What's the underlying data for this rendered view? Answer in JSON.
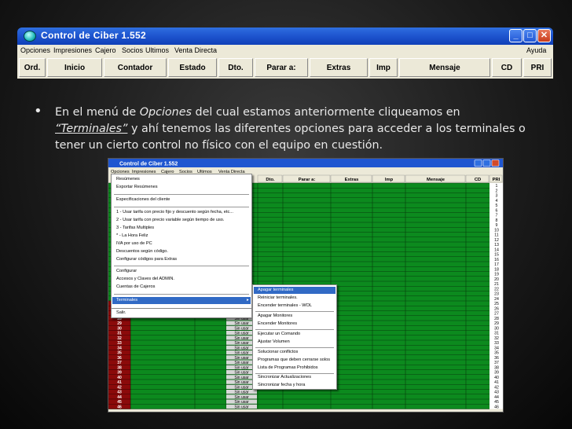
{
  "window": {
    "title": "Control de Ciber 1.552",
    "menu": [
      "Opciones",
      "Impresiones",
      "Cajero",
      "Socios",
      "Ultimos",
      "Venta Directa"
    ],
    "help": "Ayuda",
    "toolbar": [
      "Ord.",
      "Inicio",
      "Contador",
      "Estado",
      "Dto.",
      "Parar a:",
      "Extras",
      "Imp",
      "Mensaje",
      "CD",
      "PRI"
    ],
    "buttons": {
      "minimize": "_",
      "maximize": "□",
      "close": "✕"
    }
  },
  "bullet": {
    "marker": "•",
    "before": "En el menú de ",
    "opciones": "Opciones",
    "mid": " del cual estamos anteriormente cliqueamos en",
    "terminales": "“Terminales”",
    "after": " y ahí tenemos las diferentes opciones para acceder a los terminales o tener un cierto control no físico con el equipo en cuestión."
  },
  "shot": {
    "title": "Control de Ciber 1.552",
    "menu": [
      "Opciones",
      "Impresiones",
      "Cajero",
      "Socios",
      "Ultimos",
      "Venta Directa"
    ],
    "columns": [
      "Dto.",
      "Parar a:",
      "Extras",
      "Imp",
      "Mensaje",
      "CD",
      "PRI"
    ],
    "opciones_menu": [
      "Resúmenes",
      "Exportar Resúmenes",
      "Especificaciones del cliente",
      "1 - Usar tarifa con precio fijo y descuento según fecha, etc...",
      "2 - Usar tarifa con precio variable según tiempo de uso.",
      "3 - Tarifas Multiples",
      "* - La Hora Feliz",
      "IVA por uso de PC",
      "Descuentos según código.",
      "Configurar códigos para Extras",
      "Configurar",
      "Accesos y Claves del ADMIN.",
      "Cuentas de Cajeros",
      "Terminales",
      "Salir."
    ],
    "terminales_menu": [
      "Apagar terminales",
      "Reiniciar terminales.",
      "Encender terminales - WOL",
      "Apagar Monitores",
      "Encender Monitores",
      "Ejecutar un Comando",
      "Ajustar Volumen",
      "Solucionar conflictos",
      "Programas que deben cerrarse solos",
      "Lista de Programas Prohibidos",
      "Sincronizar Actualizaciones",
      "Sincronizar fecha y hora"
    ],
    "row_numbers": [
      "1",
      "2",
      "3",
      "4",
      "5",
      "6",
      "7",
      "8",
      "9",
      "10",
      "11",
      "12",
      "13",
      "14",
      "15",
      "16",
      "17",
      "18",
      "19",
      "20",
      "21",
      "22",
      "23",
      "24",
      "25",
      "26",
      "27",
      "28",
      "29",
      "30",
      "31",
      "32",
      "33",
      "34",
      "35",
      "36",
      "37",
      "38",
      "39",
      "40",
      "41",
      "42",
      "43",
      "44",
      "45",
      "46"
    ],
    "left_rows": [
      "25",
      "26",
      "27",
      "28",
      "29",
      "30",
      "31",
      "32",
      "33",
      "34",
      "35",
      "36",
      "37",
      "38",
      "39",
      "40",
      "41",
      "42",
      "43",
      "44",
      "45",
      "46"
    ],
    "status_text": "Sin usar",
    "colors": {
      "grid_green": "#0c8a1e",
      "grid_line": "#063d0d",
      "row_red": "#8b0a0a",
      "panel": "#ece9d8",
      "highlight": "#316ac5"
    }
  }
}
